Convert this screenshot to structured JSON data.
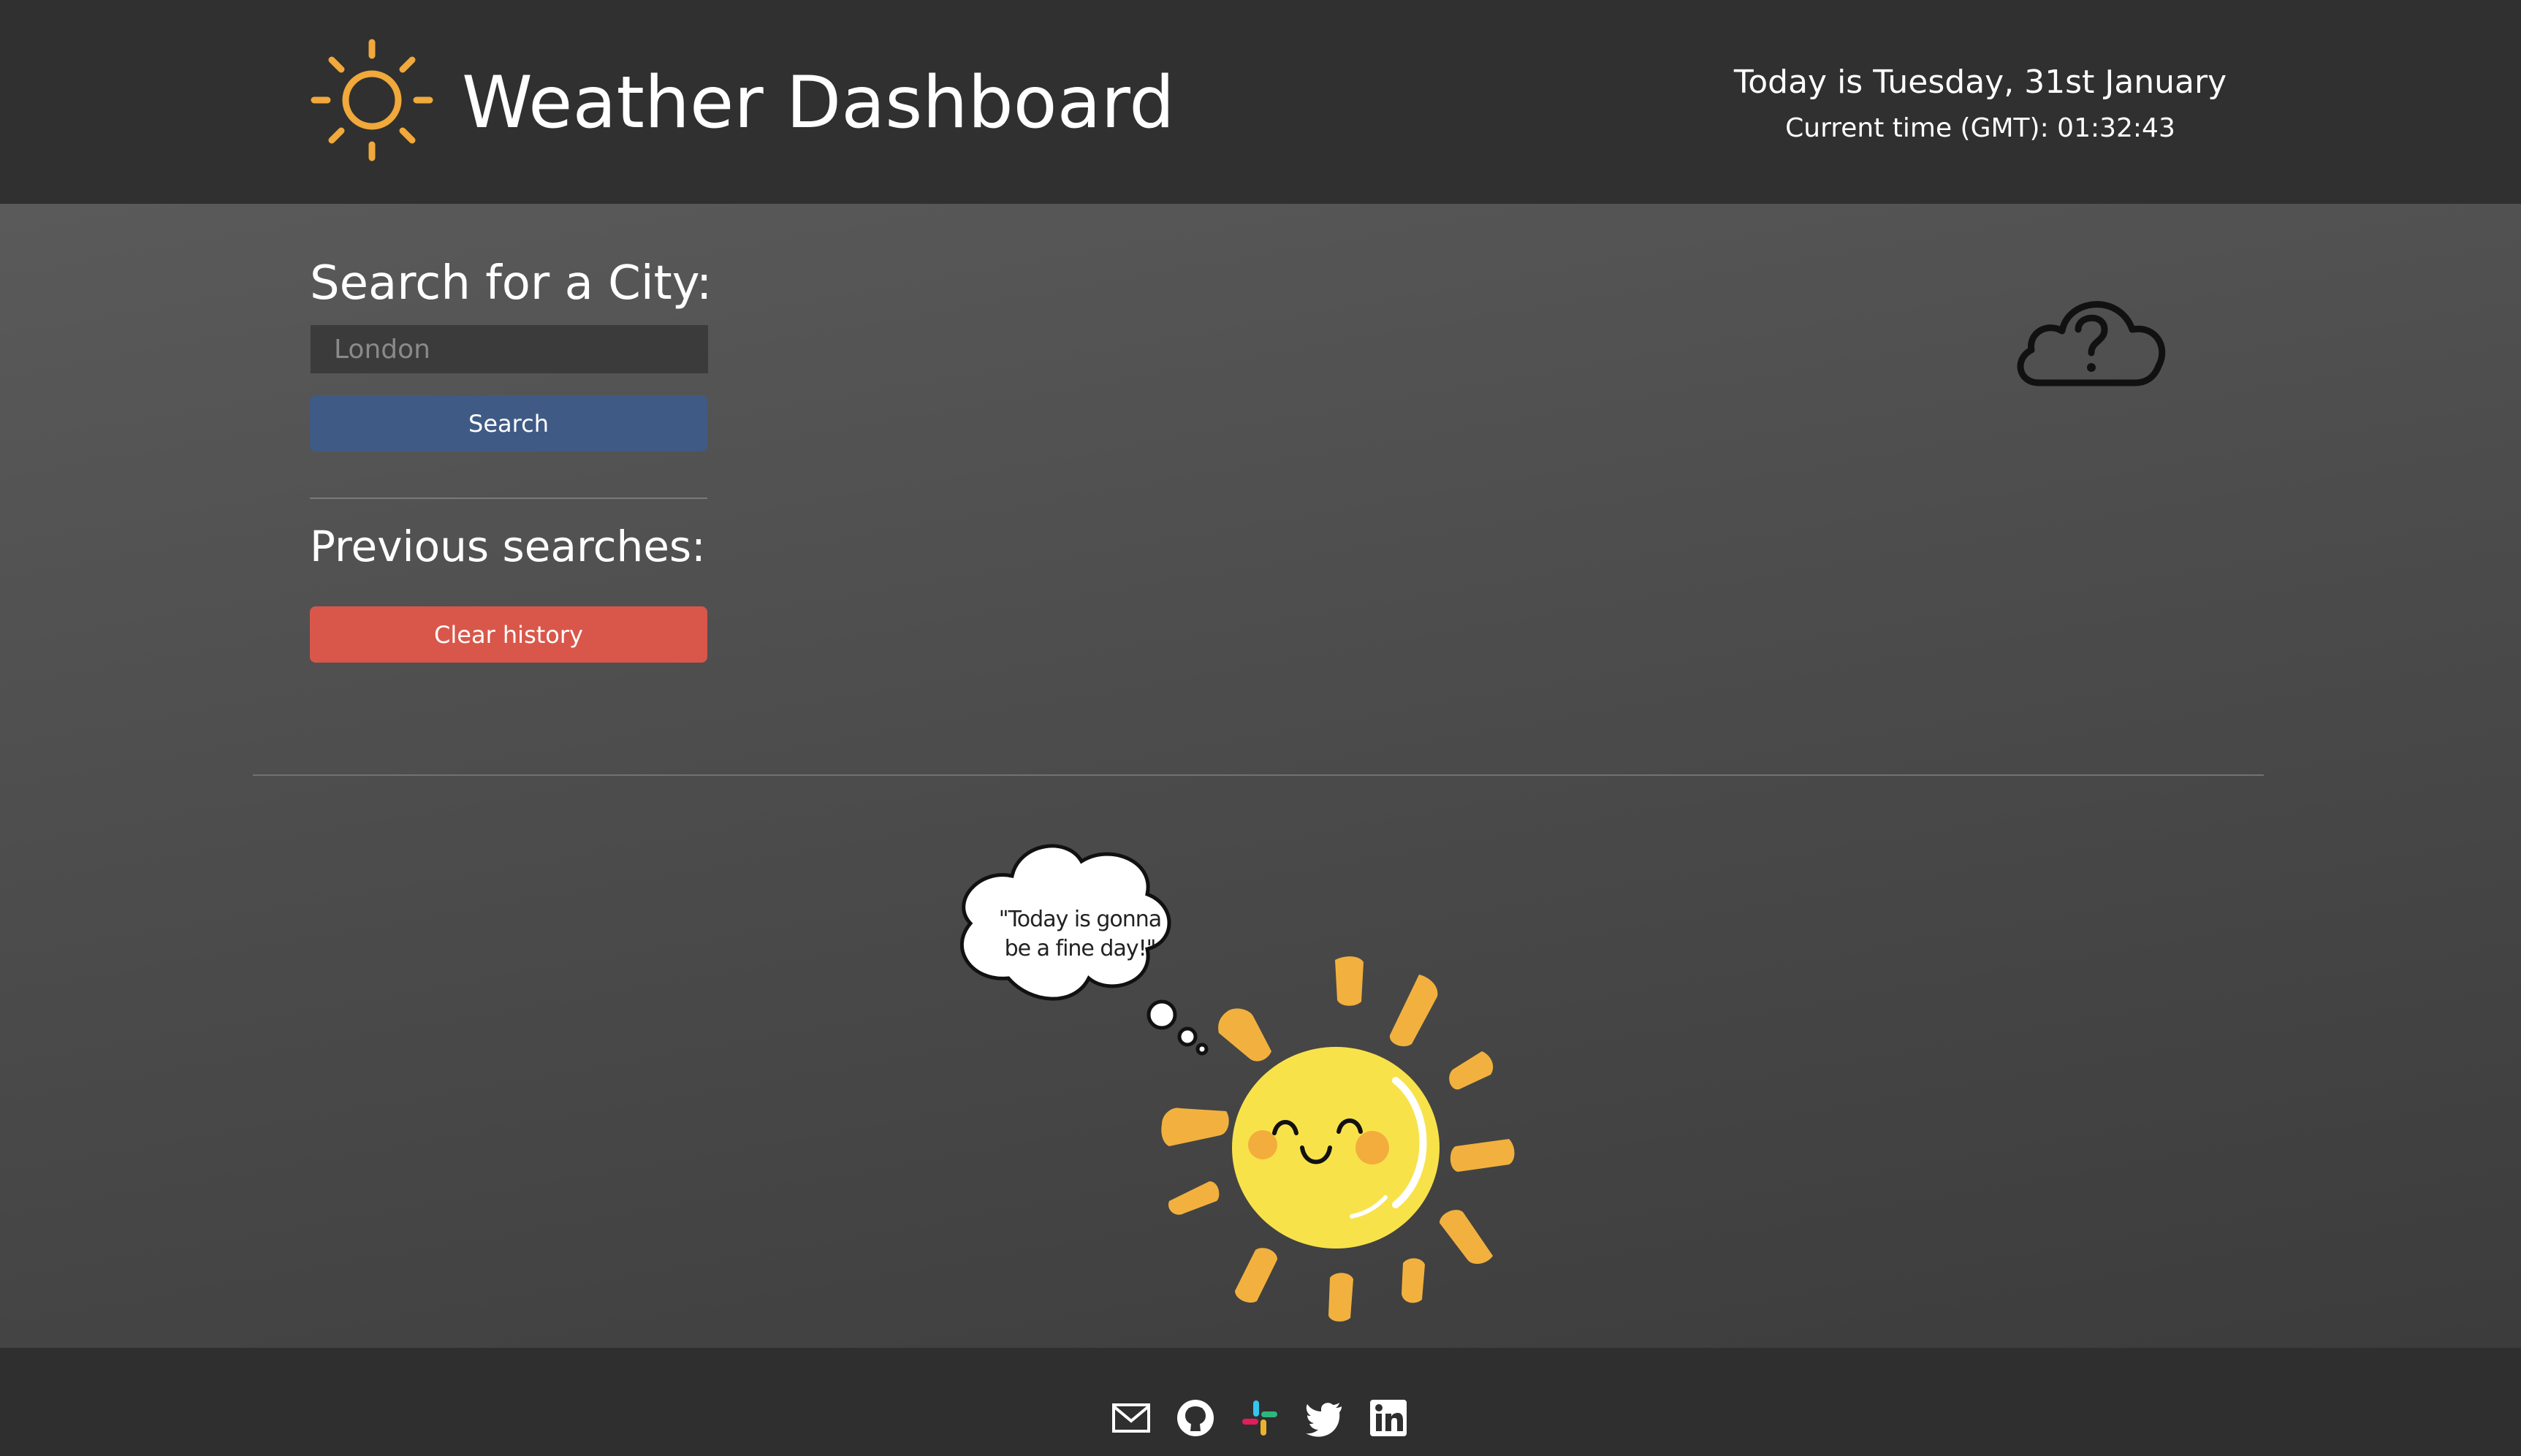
{
  "header": {
    "logo_icon": "sun-outline-icon",
    "title": "Weather Dashboard",
    "date_text": "Today is Tuesday, 31st January",
    "time_text": "Current time (GMT): 01:32:43"
  },
  "search": {
    "heading": "Search for a City:",
    "placeholder": "London",
    "button_label": "Search"
  },
  "history": {
    "heading": "Previous searches:",
    "clear_label": "Clear history",
    "items": []
  },
  "weather": {
    "status_icon": "cloud-question-icon"
  },
  "illustration": {
    "quote_line1": "\"Today is gonna",
    "quote_line2": "be a fine day!\""
  },
  "footer": {
    "links": [
      "mail-icon",
      "github-icon",
      "slack-icon",
      "twitter-icon",
      "linkedin-icon"
    ]
  },
  "colors": {
    "header_bg": "#303030",
    "accent_sun": "#f0a93a",
    "search_button": "#3f5b85",
    "clear_button": "#d9574a",
    "footer_bg": "#2f2f2f"
  }
}
